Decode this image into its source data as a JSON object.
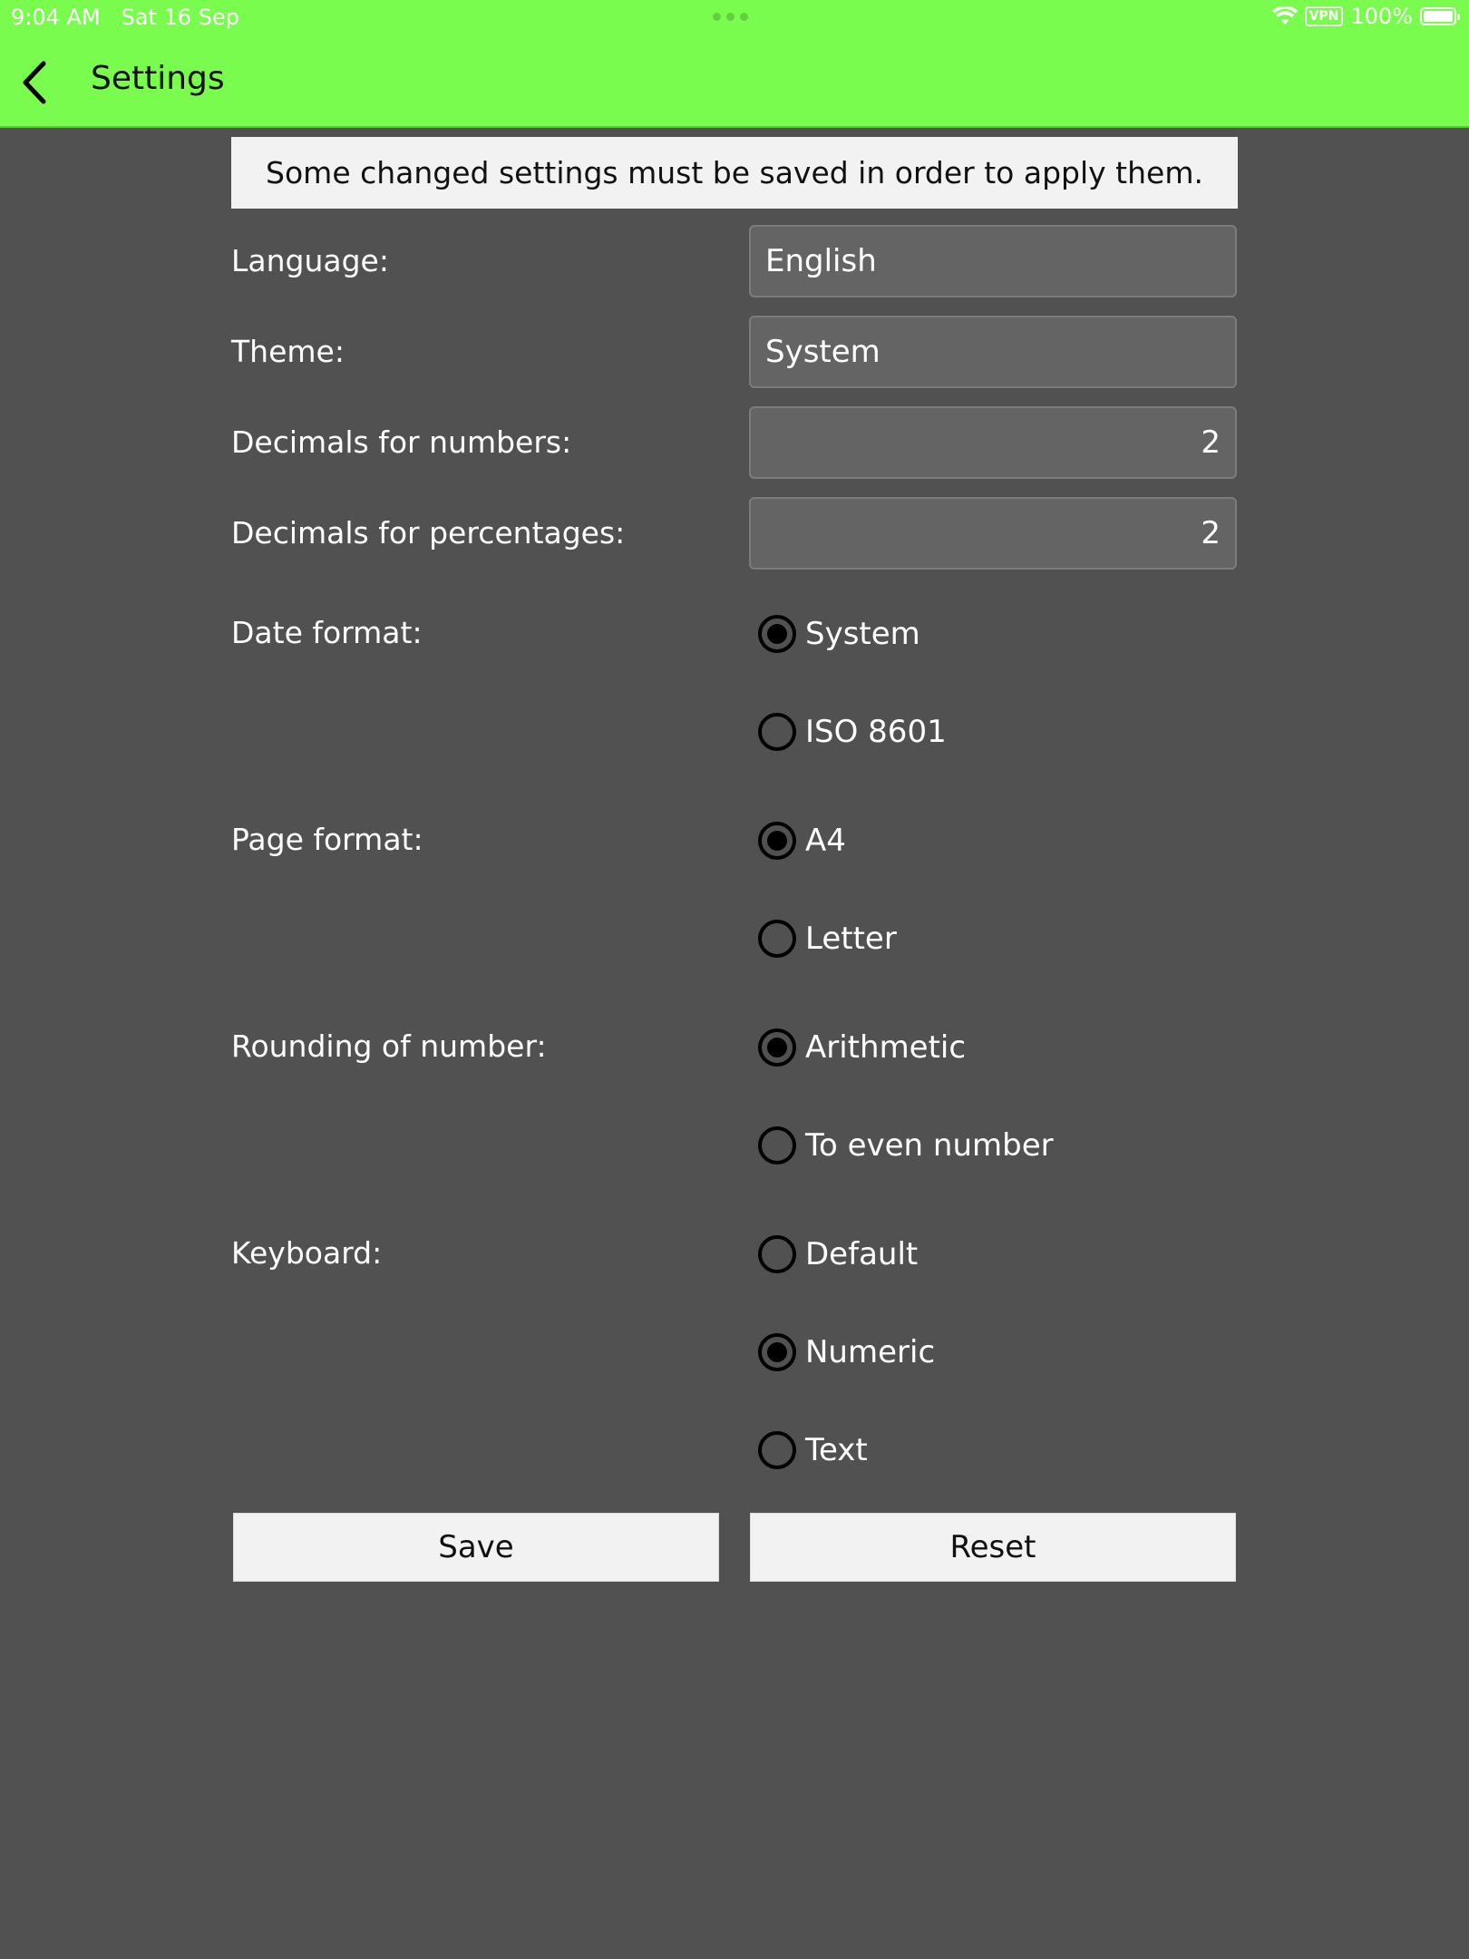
{
  "status_bar": {
    "time": "9:04 AM",
    "date": "Sat 16 Sep",
    "vpn": "VPN",
    "battery": "100%"
  },
  "nav": {
    "title": "Settings"
  },
  "banner": {
    "text": "Some changed settings must be saved in order to apply them."
  },
  "settings": {
    "language": {
      "label": "Language:",
      "value": "English"
    },
    "theme": {
      "label": "Theme:",
      "value": "System"
    },
    "decimals_numbers": {
      "label": "Decimals for numbers:",
      "value": "2"
    },
    "decimals_percentages": {
      "label": "Decimals for percentages:",
      "value": "2"
    },
    "date_format": {
      "label": "Date format:",
      "options": [
        "System",
        "ISO 8601"
      ],
      "selected": "System"
    },
    "page_format": {
      "label": "Page format:",
      "options": [
        "A4",
        "Letter"
      ],
      "selected": "A4"
    },
    "rounding": {
      "label": "Rounding of number:",
      "options": [
        "Arithmetic",
        "To even number"
      ],
      "selected": "Arithmetic"
    },
    "keyboard": {
      "label": "Keyboard:",
      "options": [
        "Default",
        "Numeric",
        "Text"
      ],
      "selected": "Numeric"
    }
  },
  "buttons": {
    "save": "Save",
    "reset": "Reset"
  },
  "colors": {
    "header": "#7afc4f",
    "background": "#515151",
    "field": "#646464",
    "button": "#f2f2f2"
  }
}
